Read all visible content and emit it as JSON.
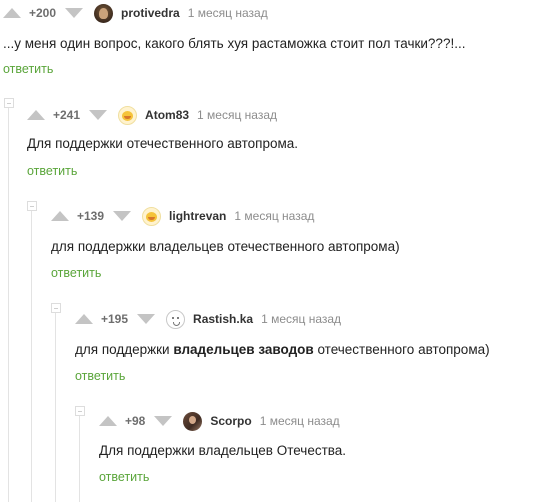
{
  "reply_label": "ответить",
  "colors": {
    "reply": "#5aa53a",
    "arrow": "#c4c4c4",
    "tree_line": "#e3e3e3"
  },
  "comments": [
    {
      "rating": "+200",
      "author": "protivedra",
      "time": "1 месяц назад",
      "avatar": "user-avatar-photo",
      "text": "...у меня один вопрос, какого блять хуя растаможка стоит пол тачки???!..."
    },
    {
      "rating": "+241",
      "author": "Atom83",
      "time": "1 месяц назад",
      "avatar": "emoji-avatar",
      "text": "Для поддержки отечественного автопрома."
    },
    {
      "rating": "+139",
      "author": "lightrevan",
      "time": "1 месяц назад",
      "avatar": "emoji-avatar",
      "text": "для поддержки владельцев отечественного автопрома)"
    },
    {
      "rating": "+195",
      "author": "Rastish.ka",
      "time": "1 месяц назад",
      "avatar": "ghost-avatar",
      "text_before": "для поддержки ",
      "text_bold": "владельцев заводов",
      "text_after": " отечественного автопрома)"
    },
    {
      "rating": "+98",
      "author": "Scorpo",
      "time": "1 месяц назад",
      "avatar": "user-avatar-photo",
      "text": "Для поддержки владельцев Отечества."
    }
  ]
}
